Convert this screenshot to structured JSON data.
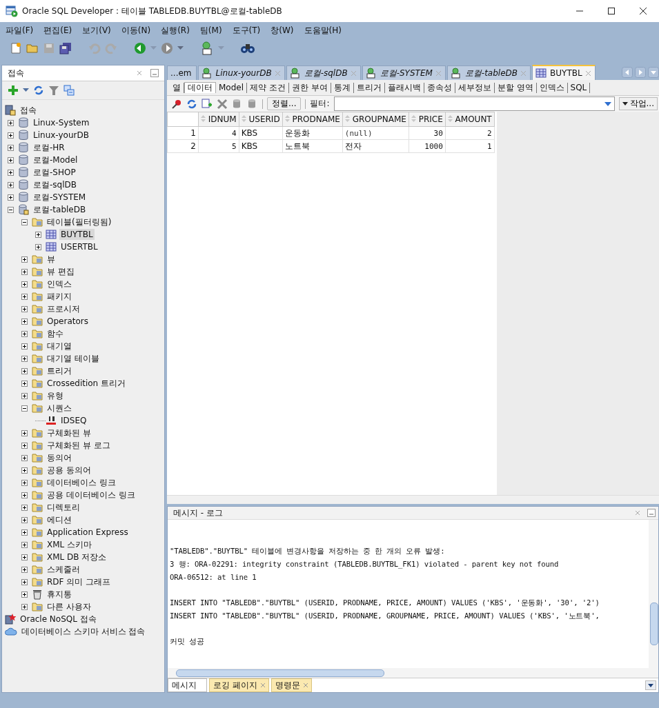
{
  "window": {
    "title": "Oracle SQL Developer : 테이블 TABLEDB.BUYTBL@로컬-tableDB"
  },
  "menu": [
    "파일(F)",
    "편집(E)",
    "보기(V)",
    "이동(N)",
    "실행(R)",
    "팀(M)",
    "도구(T)",
    "창(W)",
    "도움말(H)"
  ],
  "connections": {
    "title": "접속",
    "tree": [
      {
        "label": "접속",
        "kind": "root",
        "selected": false,
        "children": [
          {
            "label": "Linux-System",
            "kind": "db",
            "expanded": false,
            "selected": false
          },
          {
            "label": "Linux-yourDB",
            "kind": "db",
            "expanded": false,
            "selected": false
          },
          {
            "label": "로컬-HR",
            "kind": "db",
            "expanded": false,
            "selected": false
          },
          {
            "label": "로컬-Model",
            "kind": "db",
            "expanded": false,
            "selected": false
          },
          {
            "label": "로컬-SHOP",
            "kind": "db",
            "expanded": false,
            "selected": false
          },
          {
            "label": "로컬-sqlDB",
            "kind": "db",
            "expanded": false,
            "selected": false
          },
          {
            "label": "로컬-SYSTEM",
            "kind": "db",
            "expanded": false,
            "selected": false
          },
          {
            "label": "로컬-tableDB",
            "kind": "connected",
            "expanded": true,
            "selected": false,
            "children": [
              {
                "label": "테이블(필터링됨)",
                "kind": "folder",
                "expanded": true,
                "selected": false,
                "children": [
                  {
                    "label": "BUYTBL",
                    "kind": "table",
                    "expanded": false,
                    "selected": true
                  },
                  {
                    "label": "USERTBL",
                    "kind": "table",
                    "expanded": false,
                    "selected": false
                  }
                ]
              },
              {
                "label": "뷰",
                "kind": "folder",
                "expanded": false,
                "selected": false
              },
              {
                "label": "뷰 편집",
                "kind": "folder",
                "expanded": false,
                "selected": false
              },
              {
                "label": "인덱스",
                "kind": "folder",
                "expanded": false,
                "selected": false
              },
              {
                "label": "패키지",
                "kind": "folder",
                "expanded": false,
                "selected": false
              },
              {
                "label": "프로시저",
                "kind": "folder",
                "expanded": false,
                "selected": false
              },
              {
                "label": "Operators",
                "kind": "folder",
                "expanded": false,
                "selected": false
              },
              {
                "label": "함수",
                "kind": "folder",
                "expanded": false,
                "selected": false
              },
              {
                "label": "대기열",
                "kind": "folder",
                "expanded": false,
                "selected": false
              },
              {
                "label": "대기열 테이블",
                "kind": "folder",
                "expanded": false,
                "selected": false
              },
              {
                "label": "트리거",
                "kind": "folder",
                "expanded": false,
                "selected": false
              },
              {
                "label": "Crossedition 트리거",
                "kind": "folder",
                "expanded": false,
                "selected": false
              },
              {
                "label": "유형",
                "kind": "folder",
                "expanded": false,
                "selected": false
              },
              {
                "label": "시퀀스",
                "kind": "folder",
                "expanded": true,
                "selected": false,
                "children": [
                  {
                    "label": "IDSEQ",
                    "kind": "sequence",
                    "selected": false
                  }
                ]
              },
              {
                "label": "구체화된 뷰",
                "kind": "folder",
                "expanded": false,
                "selected": false
              },
              {
                "label": "구체화된 뷰 로그",
                "kind": "folder",
                "expanded": false,
                "selected": false
              },
              {
                "label": "동의어",
                "kind": "folder",
                "expanded": false,
                "selected": false
              },
              {
                "label": "공용 동의어",
                "kind": "folder",
                "expanded": false,
                "selected": false
              },
              {
                "label": "데이터베이스 링크",
                "kind": "folder",
                "expanded": false,
                "selected": false
              },
              {
                "label": "공용 데이터베이스 링크",
                "kind": "folder",
                "expanded": false,
                "selected": false
              },
              {
                "label": "디렉토리",
                "kind": "folder",
                "expanded": false,
                "selected": false
              },
              {
                "label": "에디션",
                "kind": "folder",
                "expanded": false,
                "selected": false
              },
              {
                "label": "Application Express",
                "kind": "folder",
                "expanded": false,
                "selected": false
              },
              {
                "label": "XML 스키마",
                "kind": "folder",
                "expanded": false,
                "selected": false
              },
              {
                "label": "XML DB 저장소",
                "kind": "folder",
                "expanded": false,
                "selected": false
              },
              {
                "label": "스케줄러",
                "kind": "folder",
                "expanded": false,
                "selected": false
              },
              {
                "label": "RDF 의미 그래프",
                "kind": "folder",
                "expanded": false,
                "selected": false
              },
              {
                "label": "휴지통",
                "kind": "trash",
                "expanded": false,
                "selected": false
              },
              {
                "label": "다른 사용자",
                "kind": "folder",
                "expanded": false,
                "selected": false
              }
            ]
          }
        ]
      },
      {
        "label": "Oracle NoSQL 접속",
        "kind": "nosql",
        "selected": false
      },
      {
        "label": "데이터베이스 스키마 서비스 접속",
        "kind": "cloud",
        "selected": false
      }
    ]
  },
  "editor_tabs": [
    {
      "label": "...em",
      "kind": "overflow",
      "selected": false
    },
    {
      "label": "Linux-yourDB",
      "kind": "worksheet",
      "selected": false
    },
    {
      "label": "로컬-sqlDB",
      "kind": "worksheet",
      "selected": false
    },
    {
      "label": "로컬-SYSTEM",
      "kind": "worksheet",
      "selected": false
    },
    {
      "label": "로컬-tableDB",
      "kind": "worksheet",
      "selected": false
    },
    {
      "label": "BUYTBL",
      "kind": "table",
      "selected": true
    }
  ],
  "sub_tabs": [
    {
      "label": "열",
      "selected": false
    },
    {
      "label": "데이터",
      "selected": true
    },
    {
      "label": "Model",
      "selected": false
    },
    {
      "label": "제약 조건",
      "selected": false
    },
    {
      "label": "권한 부여",
      "selected": false
    },
    {
      "label": "통계",
      "selected": false
    },
    {
      "label": "트리거",
      "selected": false
    },
    {
      "label": "플래시백",
      "selected": false
    },
    {
      "label": "종속성",
      "selected": false
    },
    {
      "label": "세부정보",
      "selected": false
    },
    {
      "label": "분할 영역",
      "selected": false
    },
    {
      "label": "인덱스",
      "selected": false
    },
    {
      "label": "SQL",
      "selected": false
    }
  ],
  "data_toolbar": {
    "sort_button": "정렬...",
    "filter_label": "필터:",
    "actions_button": "작업..."
  },
  "grid": {
    "columns": [
      {
        "label": "IDNUM",
        "kind": "number"
      },
      {
        "label": "USERID",
        "kind": "text"
      },
      {
        "label": "PRODNAME",
        "kind": "text"
      },
      {
        "label": "GROUPNAME",
        "kind": "text"
      },
      {
        "label": "PRICE",
        "kind": "number"
      },
      {
        "label": "AMOUNT",
        "kind": "number"
      }
    ],
    "rows": [
      {
        "number": "1",
        "cells": [
          "4",
          "KBS",
          "운동화",
          "(null)",
          "30",
          "2"
        ]
      },
      {
        "number": "2",
        "cells": [
          "5",
          "KBS",
          "노트북",
          "전자",
          "1000",
          "1"
        ]
      }
    ]
  },
  "log": {
    "title": "메시지 - 로그",
    "blocks": [
      [
        "\"TABLEDB\".\"BUYTBL\" 테이블에 변경사항을 저장하는 중 한 개의 오류 발생:",
        "3 행: ORA-02291: integrity constraint (TABLEDB.BUYTBL_FK1) violated - parent key not found",
        "ORA-06512: at line 1"
      ],
      [
        "INSERT INTO \"TABLEDB\".\"BUYTBL\" (USERID, PRODNAME, PRICE, AMOUNT) VALUES ('KBS', '운동화', '30', '2')",
        "INSERT INTO \"TABLEDB\".\"BUYTBL\" (USERID, PRODNAME, GROUPNAME, PRICE, AMOUNT) VALUES ('KBS', '노트북',"
      ],
      [
        "커밋 성공"
      ]
    ],
    "tabs": [
      {
        "label": "메시지",
        "selected": true,
        "closable": false
      },
      {
        "label": "로깅 페이지",
        "selected": false,
        "closable": true
      },
      {
        "label": "명령문",
        "selected": false,
        "closable": true
      }
    ]
  }
}
